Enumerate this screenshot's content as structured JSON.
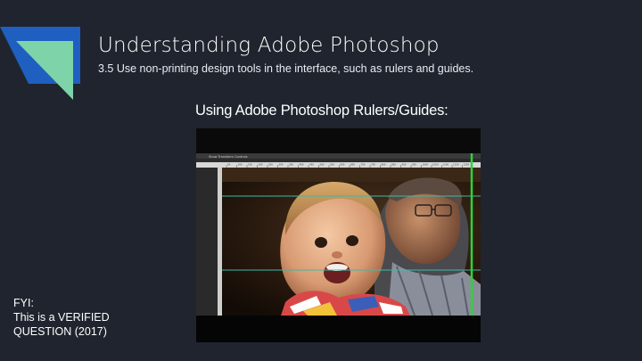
{
  "slide": {
    "title": "Understanding Adobe Photoshop",
    "subtitle": "3.5 Use non-printing design tools in the interface, such as rulers and guides.",
    "image_caption": "Using Adobe Photoshop Rulers/Guides:",
    "footnote": {
      "line1": "FYI:",
      "line2": "This is a VERIFIED",
      "line3": "QUESTION (2017)"
    }
  },
  "colors": {
    "background": "#1f242e",
    "deco_blue": "#1f5fc0",
    "deco_green": "#7fd3a8",
    "guide_cyan": "#3fb9a8",
    "guide_green": "#2bd33d"
  },
  "screenshot": {
    "options_text": "Show Transform Controls",
    "ruler_ticks": [
      "50",
      "100",
      "150",
      "200",
      "250",
      "300",
      "350",
      "400",
      "450",
      "500",
      "550",
      "600",
      "650",
      "700",
      "750",
      "800",
      "850",
      "900",
      "950",
      "1000",
      "1050",
      "1100",
      "1150",
      "1200"
    ]
  }
}
